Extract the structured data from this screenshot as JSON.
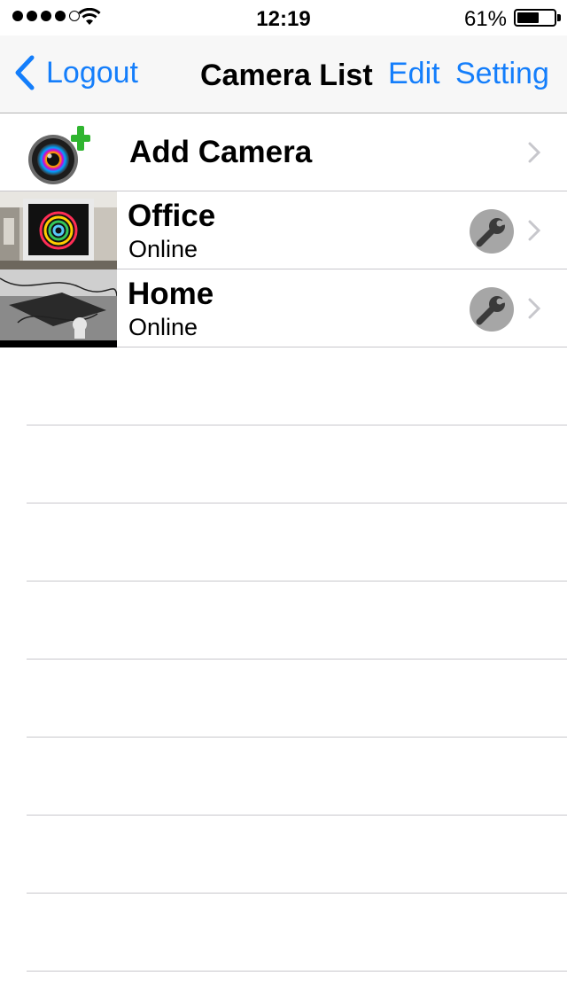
{
  "status_bar": {
    "signal_bars_filled": 4,
    "signal_bars_total": 5,
    "time": "12:19",
    "battery_percent_text": "61%",
    "battery_level": 0.61
  },
  "nav": {
    "back_label": "Logout",
    "title": "Camera List",
    "edit_label": "Edit",
    "setting_label": "Setting",
    "accent_color": "#147efb"
  },
  "add_camera": {
    "label": "Add Camera",
    "icon": "camera-add-icon"
  },
  "cameras": [
    {
      "name": "Office",
      "status": "Online",
      "thumbnail": "office-camera-snapshot"
    },
    {
      "name": "Home",
      "status": "Online",
      "thumbnail": "home-camera-snapshot"
    }
  ],
  "icons": {
    "settings": "wrench-icon",
    "disclosure": "chevron-right-icon",
    "back": "chevron-left-icon"
  }
}
